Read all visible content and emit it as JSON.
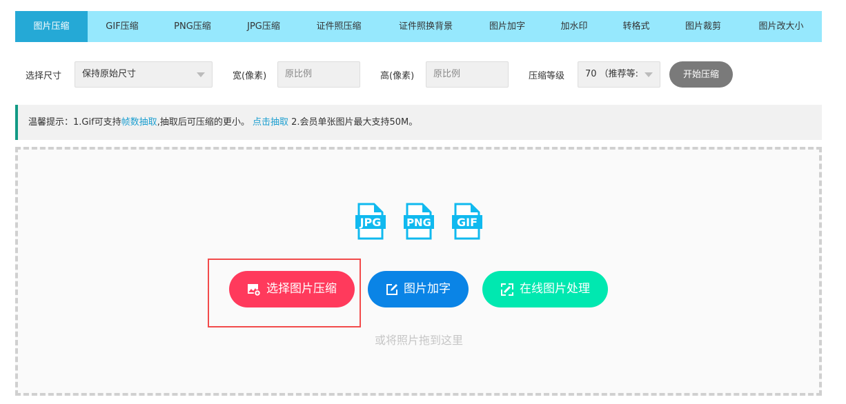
{
  "tabs": [
    "图片压缩",
    "GIF压缩",
    "PNG压缩",
    "JPG压缩",
    "证件照压缩",
    "证件照换背景",
    "图片加字",
    "加水印",
    "转格式",
    "图片裁剪",
    "图片改大小"
  ],
  "controls": {
    "size_label": "选择尺寸",
    "size_value": "保持原始尺寸",
    "width_label": "宽(像素)",
    "width_placeholder": "原比例",
    "height_label": "高(像素)",
    "height_placeholder": "原比例",
    "level_label": "压缩等级",
    "level_value": "70 （推荐等:",
    "start_label": "开始压缩"
  },
  "notice": {
    "prefix": "温馨提示：1.Gif可支持",
    "link1": "帧数抽取",
    "mid": ",抽取后可压缩的更小。 ",
    "link2": "点击抽取",
    "suffix": " 2.会员单张图片最大支持50M。"
  },
  "formats": [
    "JPG",
    "PNG",
    "GIF"
  ],
  "buttons": {
    "select": "选择图片压缩",
    "addtext": "图片加字",
    "online": "在线图片处理"
  },
  "drag_hint": "或将照片拖到这里",
  "colors": {
    "tab_bar": "#96e8fd",
    "tab_active": "#25a9d6",
    "select_btn": "#ff3a5c",
    "addtext_btn": "#0a84e6",
    "online_btn": "#00e8b0",
    "icon": "#10b9ef"
  }
}
